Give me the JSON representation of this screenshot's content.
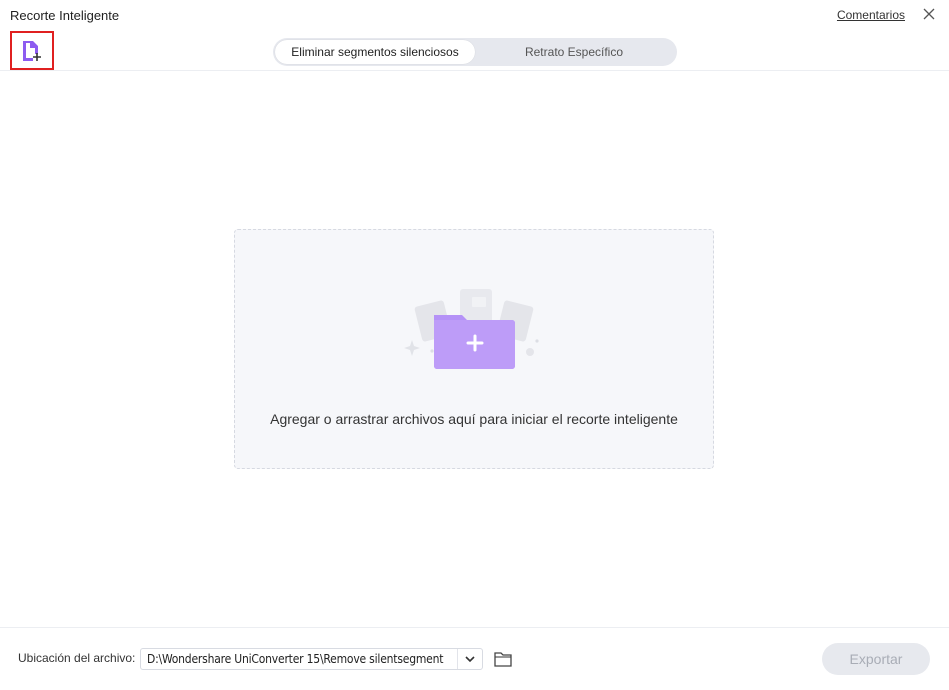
{
  "window": {
    "title": "Recorte Inteligente",
    "feedback_link": "Comentarios"
  },
  "toolbar": {
    "add_file_icon": "add-file-icon",
    "tabs": [
      {
        "label": "Eliminar segmentos silenciosos",
        "active": true
      },
      {
        "label": "Retrato Específico",
        "active": false
      }
    ]
  },
  "dropzone": {
    "text": "Agregar o arrastrar archivos aquí para iniciar el recorte inteligente",
    "icon": "add-folder-icon"
  },
  "footer": {
    "location_label": "Ubicación del archivo:",
    "path_value": "D:\\Wondershare UniConverter 15\\Remove silentsegment",
    "export_label": "Exportar",
    "export_enabled": false
  },
  "colors": {
    "accent_purple": "#8d5cf0",
    "folder_purple": "#b592f7",
    "highlight_red": "#e02020",
    "disabled_button": "#e7e9ee"
  }
}
